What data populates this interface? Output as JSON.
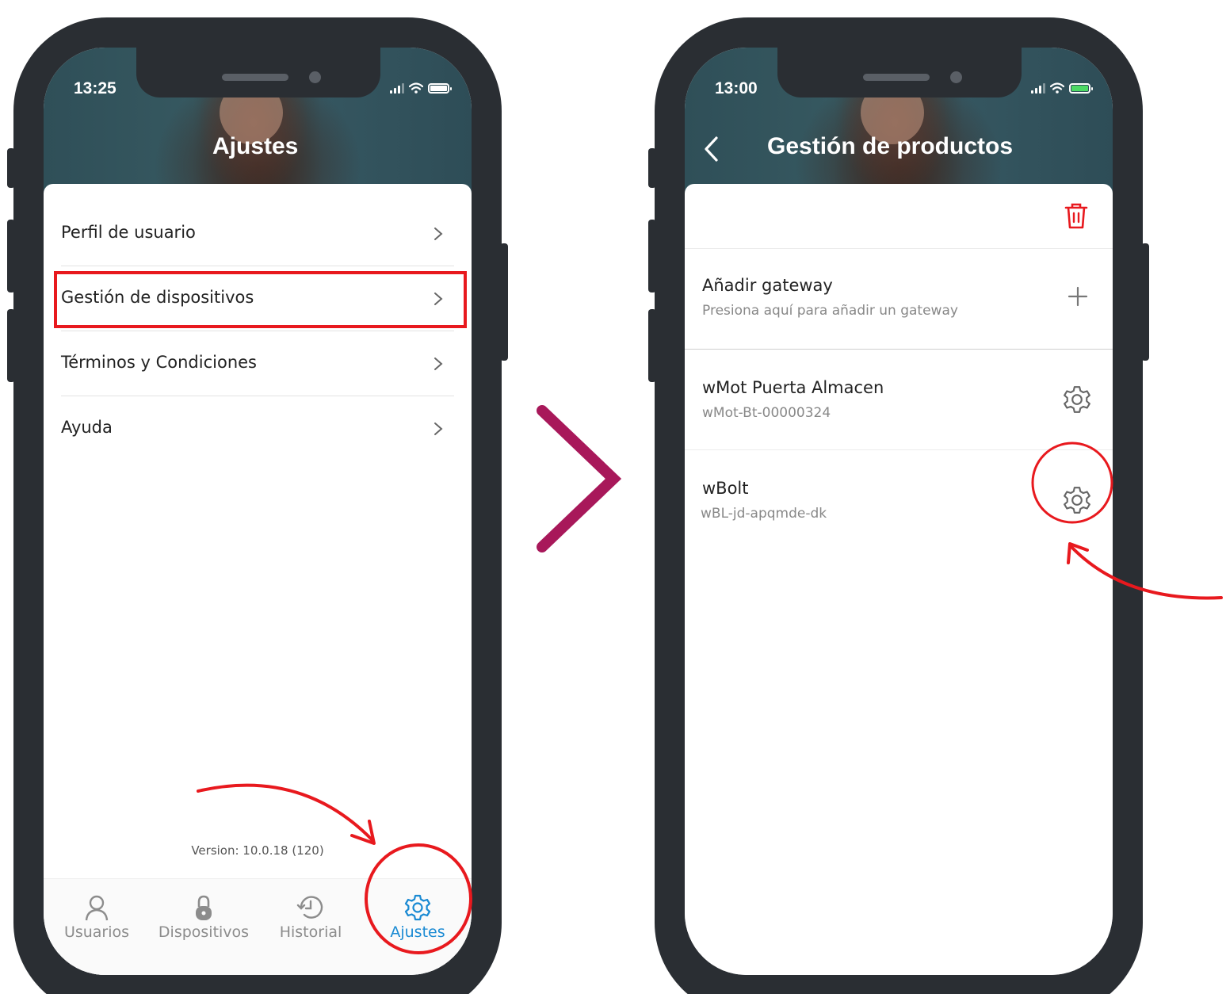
{
  "screen_left": {
    "status_time": "13:25",
    "title": "Ajustes",
    "menu": [
      {
        "label": "Perfil de usuario"
      },
      {
        "label": "Gestión de dispositivos"
      },
      {
        "label": "Términos y Condiciones"
      },
      {
        "label": "Ayuda"
      }
    ],
    "version": "Version: 10.0.18 (120)",
    "tabs": [
      {
        "label": "Usuarios",
        "icon": "user-icon"
      },
      {
        "label": "Dispositivos",
        "icon": "lock-icon"
      },
      {
        "label": "Historial",
        "icon": "history-icon"
      },
      {
        "label": "Ajustes",
        "icon": "gear-icon",
        "active": true
      }
    ]
  },
  "screen_right": {
    "status_time": "13:00",
    "title": "Gestión de productos",
    "add_row": {
      "title": "Añadir gateway",
      "subtitle": "Presiona aquí para añadir un gateway"
    },
    "products": [
      {
        "title": "wMot Puerta Almacen",
        "subtitle": "wMot-Bt-00000324"
      },
      {
        "title": "wBolt",
        "subtitle": "wBL-jd-apqmde-dk"
      }
    ]
  },
  "colors": {
    "phone_frame": "#2a2e33",
    "highlight_red": "#e8191e",
    "active_tab": "#1a8ad3",
    "trash_red": "#e8191e",
    "transition_arrow": "#a8185a",
    "battery_charging": "#4cd964"
  }
}
